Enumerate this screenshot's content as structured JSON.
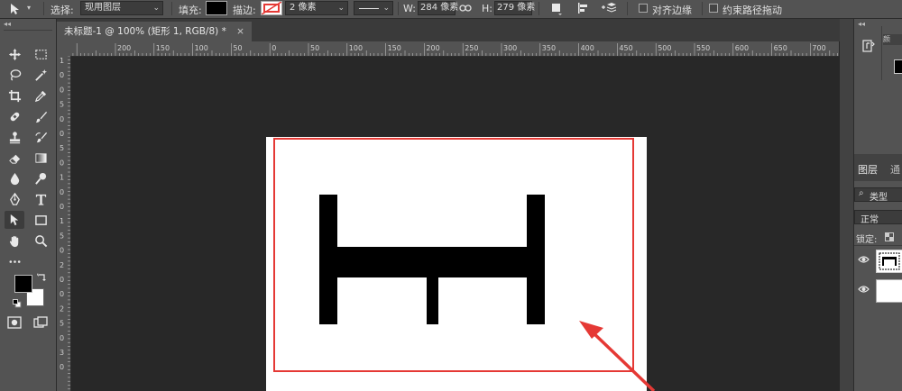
{
  "options_bar": {
    "select_label": "选择:",
    "select_value": "现用图层",
    "fill_label": "填充:",
    "stroke_label": "描边:",
    "stroke_width": "2 像素",
    "w_label": "W:",
    "w_value": "284 像素",
    "h_label": "H:",
    "h_value": "279 像素",
    "align_edges_label": "对齐边缘",
    "constrain_path_label": "约束路径拖动"
  },
  "document": {
    "tab_title": "未标题-1 @ 100% (矩形 1, RGB/8) *",
    "close_glyph": "×"
  },
  "ruler": {
    "h_ticks": [
      "200",
      "150",
      "100",
      "50",
      "0",
      "50",
      "100",
      "150",
      "200",
      "250",
      "300",
      "350",
      "400",
      "450",
      "500",
      "550",
      "600",
      "650",
      "700"
    ],
    "v_ticks": [
      "1",
      "0",
      "0",
      "5",
      "0",
      "0",
      "5",
      "0",
      "1",
      "0",
      "0",
      "1",
      "5",
      "0",
      "2",
      "0",
      "0",
      "2",
      "5",
      "0",
      "3",
      "0"
    ]
  },
  "layers_panel": {
    "tab_layers": "图层",
    "tab_channels": "通",
    "filter_label": "类型",
    "blend_mode": "正常",
    "lock_label": "锁定:"
  },
  "colors": {
    "foreground": "#000000",
    "background": "#ffffff",
    "highlight": "#e53935"
  }
}
